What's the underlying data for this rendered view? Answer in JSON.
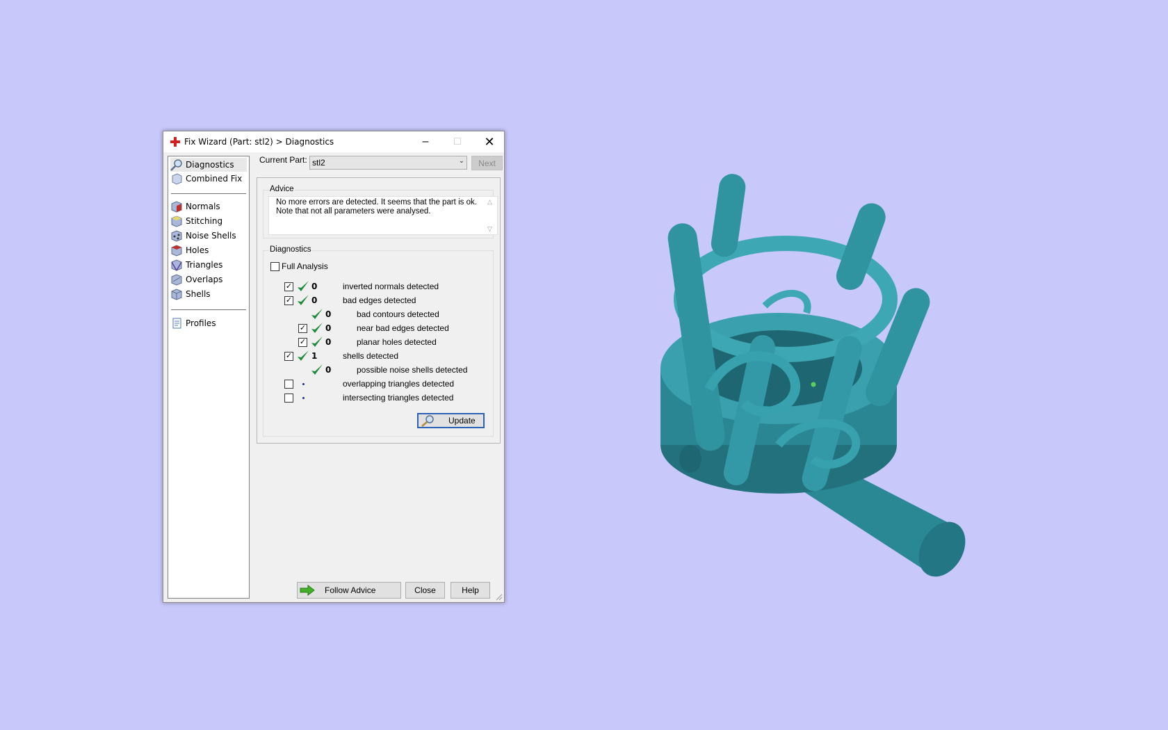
{
  "window": {
    "title": "Fix Wizard (Part: stl2) > Diagnostics",
    "minimize_icon": "minimize-icon",
    "maximize_icon": "maximize-icon",
    "close_icon": "close-icon"
  },
  "sidebar": {
    "items": [
      {
        "label": "Diagnostics",
        "icon": "magnifier-icon",
        "selected": true
      },
      {
        "label": "Combined Fix",
        "icon": "cube-icon"
      },
      {
        "label": "Normals",
        "icon": "normals-cube-icon"
      },
      {
        "label": "Stitching",
        "icon": "stitching-cube-icon"
      },
      {
        "label": "Noise Shells",
        "icon": "noise-shells-cube-icon"
      },
      {
        "label": "Holes",
        "icon": "holes-cube-icon"
      },
      {
        "label": "Triangles",
        "icon": "triangles-cube-icon"
      },
      {
        "label": "Overlaps",
        "icon": "overlaps-cube-icon"
      },
      {
        "label": "Shells",
        "icon": "shells-cube-icon"
      },
      {
        "label": "Profiles",
        "icon": "document-icon"
      }
    ]
  },
  "header": {
    "current_part_label": "Current Part:",
    "current_part_value": "stl2",
    "next_label": "Next"
  },
  "advice": {
    "group_title": "Advice",
    "line1": "No more errors are detected. It seems that the part is ok.",
    "line2": "Note that not all parameters were analysed."
  },
  "diagnostics": {
    "group_title": "Diagnostics",
    "full_analysis_label": "Full Analysis",
    "full_analysis_checked": false,
    "rows": [
      {
        "count": "0",
        "label": "inverted normals detected",
        "checked": true,
        "status": "ok"
      },
      {
        "count": "0",
        "label": "bad edges detected",
        "checked": true,
        "status": "ok"
      },
      {
        "count": "0",
        "label": "bad contours detected",
        "status": "ok"
      },
      {
        "count": "0",
        "label": "near bad edges detected",
        "checked": true,
        "status": "ok"
      },
      {
        "count": "0",
        "label": "planar holes detected",
        "checked": true,
        "status": "ok"
      },
      {
        "count": "1",
        "label": "shells detected",
        "checked": true,
        "status": "ok"
      },
      {
        "count": "0",
        "label": "possible noise shells detected",
        "status": "ok"
      },
      {
        "count": "",
        "label": "overlapping triangles detected",
        "checked": false,
        "status": "not-analysed"
      },
      {
        "count": "",
        "label": "intersecting triangles detected",
        "checked": false,
        "status": "not-analysed"
      }
    ],
    "update_label": "Update"
  },
  "footer": {
    "follow_advice_label": "Follow Advice",
    "close_label": "Close",
    "help_label": "Help"
  },
  "colors": {
    "background": "#c8c8fa",
    "model": "#2b8a97",
    "check_green": "#1e8c3a",
    "focus_blue": "#2a60b5"
  }
}
